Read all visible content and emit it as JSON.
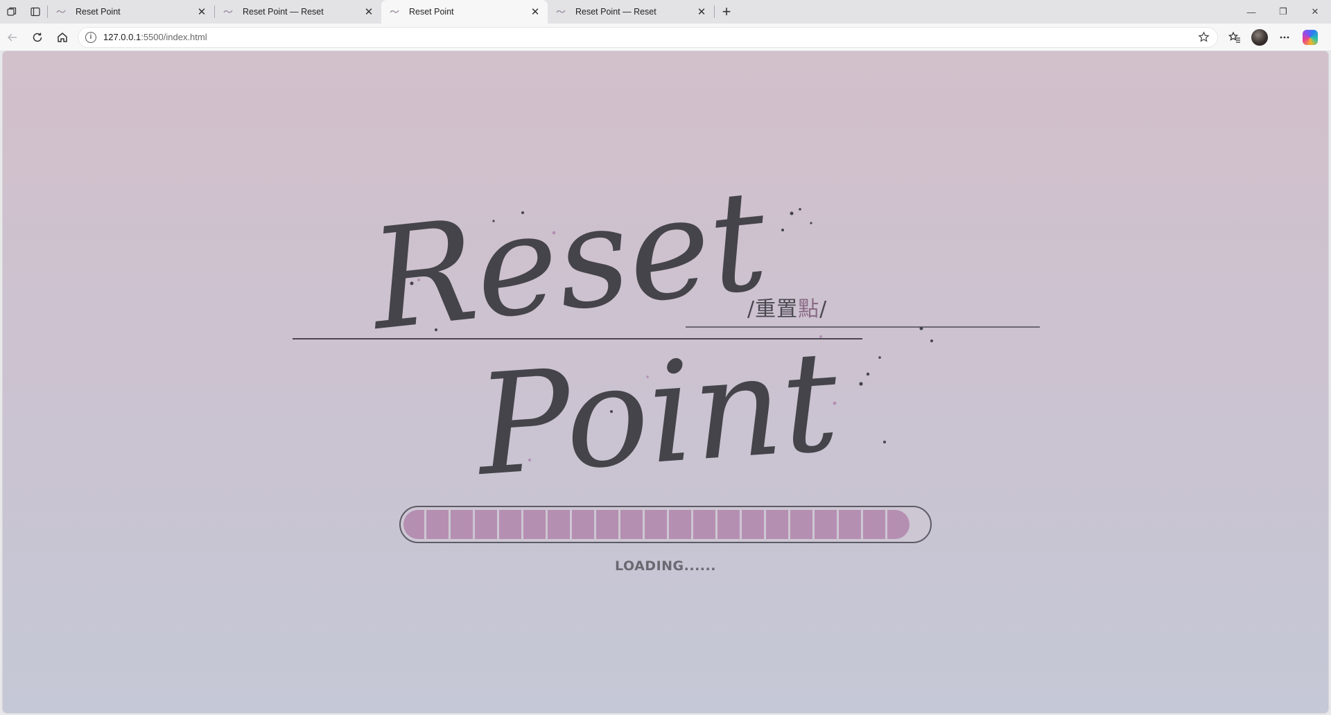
{
  "browser": {
    "tabs": [
      {
        "title": "Reset Point",
        "active": false
      },
      {
        "title": "Reset Point — Reset",
        "active": false
      },
      {
        "title": "Reset Point",
        "active": true
      },
      {
        "title": "Reset Point — Reset",
        "active": false
      }
    ],
    "address": {
      "host": "127.0.0.1",
      "path": ":5500/index.html"
    },
    "icons": {
      "workspaces": "workspaces-icon",
      "tab_actions": "tab-actions-icon",
      "new_tab": "plus-icon",
      "back": "back-arrow-icon",
      "refresh": "refresh-icon",
      "home": "home-icon",
      "info": "info-icon",
      "favorite": "star-icon",
      "favorites": "favorites-icon",
      "more": "more-icon",
      "copilot": "copilot-icon"
    }
  },
  "page": {
    "logo_word_1": "Reset",
    "logo_word_2": "Point",
    "subtitle_a": "/重置",
    "subtitle_b": "點",
    "subtitle_c": "/",
    "loading_text": "LOADING......",
    "progress": {
      "filled_segments": 21,
      "total_segments": 21
    },
    "colors": {
      "ink": "#45444a",
      "accent_pink": "#b58fb2",
      "bg_top": "#d2c0cb",
      "bg_bottom": "#c5c8d6"
    }
  }
}
